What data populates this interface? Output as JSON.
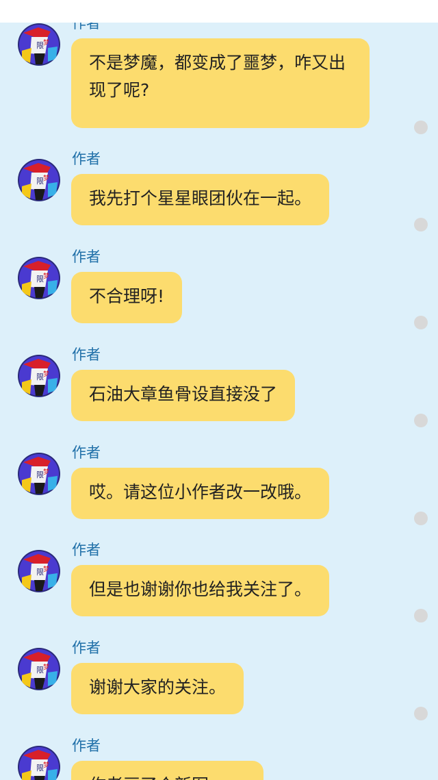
{
  "colors": {
    "background": "#ddf0fa",
    "bubble": "#fcdc6e",
    "sender_name": "#1f6fa8",
    "read_dot": "#d8d8d8"
  },
  "avatar_icon": "avatar-icon",
  "messages": [
    {
      "sender": "作者",
      "text": "不是梦魔，都变成了噩梦，咋又出现了呢?"
    },
    {
      "sender": "作者",
      "text": "我先打个星星眼团伙在一起。"
    },
    {
      "sender": "作者",
      "text": "不合理呀!"
    },
    {
      "sender": "作者",
      "text": "石油大章鱼骨设直接没了"
    },
    {
      "sender": "作者",
      "text": "哎。请这位小作者改一改哦。"
    },
    {
      "sender": "作者",
      "text": "但是也谢谢你也给我关注了。"
    },
    {
      "sender": "作者",
      "text": "谢谢大家的关注。"
    },
    {
      "sender": "作者",
      "text": "作者画了个新图"
    }
  ]
}
